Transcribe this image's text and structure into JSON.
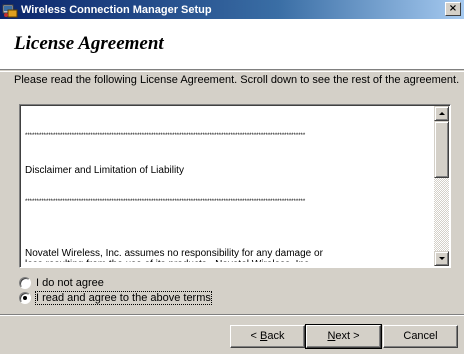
{
  "window": {
    "title": "Wireless Connection Manager Setup",
    "close_label": "×"
  },
  "header": {
    "title": "License Agreement"
  },
  "instruction": "Please read the following License Agreement.  Scroll down to see the rest of the agreement.",
  "license": {
    "stars": "************************************************************************************************************************",
    "heading": "Disclaimer and Limitation of Liability",
    "body": "Novatel Wireless, Inc. assumes no responsibility for any damage or\nloss resulting from the use of its products.  Novatel Wireless, Inc.\nassumes no responsibility for any loss or claims by third parties,\nwhich may arise through the use of its products.  Novatel Wireless,\nInc. assumes no responsibility for any damage or loss caused by deletion\nor loss of data as a result of malfunction, or repairs.  Be sure to\nmake backup copies of all important data on other media to protect\nagainst data loss."
  },
  "options": {
    "disagree": "I do not agree",
    "agree": "I read and agree to the above terms",
    "selected": "agree"
  },
  "buttons": {
    "back_prefix": "< ",
    "back_key": "B",
    "back_rest": "ack",
    "next_key": "N",
    "next_rest": "ext >",
    "cancel": "Cancel"
  }
}
